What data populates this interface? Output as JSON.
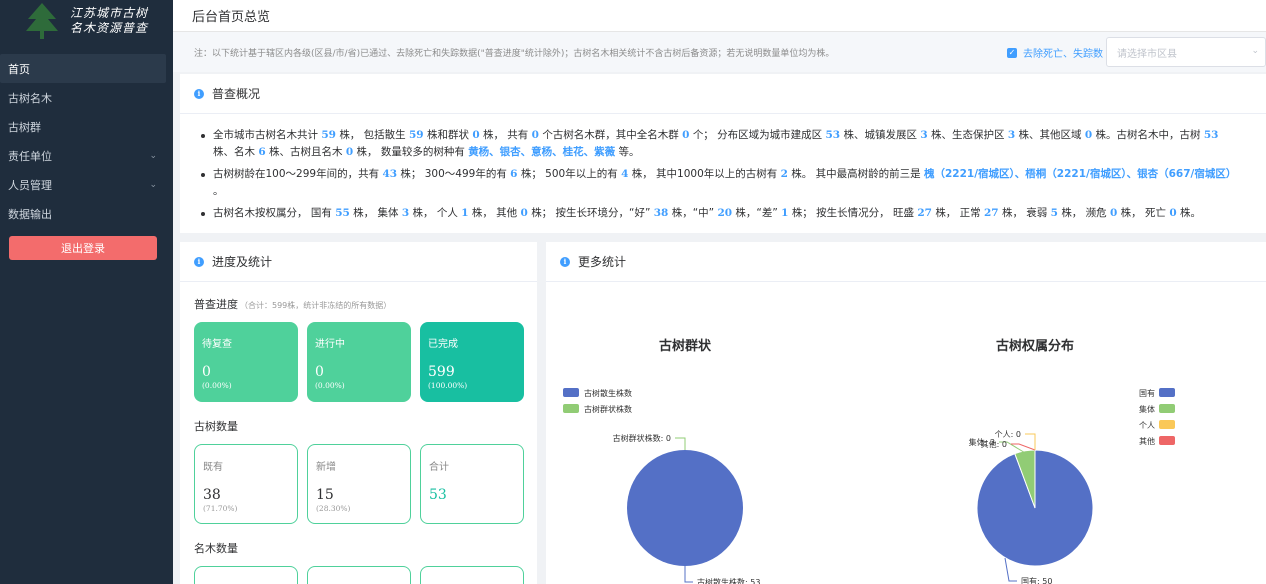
{
  "sidebar": {
    "logo_line1": "江苏城市古树",
    "logo_line2": "名木资源普查",
    "items": [
      {
        "label": "首页"
      },
      {
        "label": "古树名木"
      },
      {
        "label": "古树群"
      },
      {
        "label": "责任单位"
      },
      {
        "label": "人员管理"
      },
      {
        "label": "数据输出"
      }
    ],
    "logout": "退出登录"
  },
  "topbar": {
    "title": "后台首页总览"
  },
  "note": {
    "text": "注：以下统计基于辖区内各级(区县/市/省)已通过、去除死亡和失踪数据(\"普查进度\"统计除外)；古树名木相关统计不含古树后备资源；若无说明数量单位均为株。",
    "checkbox_label": "去除死亡、失踪数",
    "select_placeholder": "请选择市区县"
  },
  "survey": {
    "title": "普查概况",
    "l1": {
      "a": "全市城市古树名木共计",
      "total": "59",
      "b": "株， 包括散生",
      "scattered": "59",
      "c": "株和群状",
      "group": "0",
      "d": "株， 共有",
      "groups": "0",
      "e": "个古树名木群，其中全名木群",
      "fullgroups": "0",
      "f": "个； 分布区域为城市建成区",
      "urban": "53",
      "g": "株、城镇发展区",
      "town": "3",
      "h": "株、生态保护区",
      "eco": "3",
      "i": "株、其他区域",
      "other": "0",
      "j": "株。古树名木中，古树",
      "ancient": "53",
      "k": "株、名木",
      "famous": "6",
      "l": "株、古树且名木",
      "both": "0",
      "m": "株， 数量较多的树种有",
      "species": "黄杨、银杏、意杨、桂花、紫薇",
      "n": "等。"
    },
    "l2": {
      "a": "古树树龄在100～299年间的，共有",
      "c1": "43",
      "b": "株；  300～499年的有",
      "c2": "6",
      "c": "株；  500年以上的有",
      "c3": "4",
      "d": "株， 其中1000年以上的古树有",
      "c4": "2",
      "e": "株。 其中最高树龄的前三是",
      "top3": "槐（2221/宿城区）、梧桐（2221/宿城区）、银杏（667/宿城区）",
      "f": "。"
    },
    "l3": {
      "a": "古树名木按权属分， 国有",
      "gov": "55",
      "b": "株， 集体",
      "coll": "3",
      "c": "株， 个人",
      "ind": "1",
      "d": "株， 其他",
      "oth": "0",
      "e": "株； 按生长环境分，“好”",
      "good": "38",
      "f": "株，“中”",
      "mid": "20",
      "g": "株，“差”",
      "bad": "1",
      "h": "株； 按生长情况分， 旺盛",
      "vig": "27",
      "i": "株， 正常",
      "norm": "27",
      "j": "株， 衰弱",
      "weak": "5",
      "k": "株， 濒危",
      "endg": "0",
      "l": "株， 死亡",
      "dead": "0",
      "m": "株。"
    }
  },
  "progress": {
    "title": "进度及统计",
    "survey_label": "普查进度",
    "survey_note": "（合计：599株，统计非冻结的所有数据）",
    "cards": [
      {
        "title": "待复查",
        "value": "0",
        "pct": "(0.00%)"
      },
      {
        "title": "进行中",
        "value": "0",
        "pct": "(0.00%)"
      },
      {
        "title": "已完成",
        "value": "599",
        "pct": "(100.00%)"
      }
    ],
    "count_label": "古树数量",
    "count_cards": [
      {
        "title": "既有",
        "value": "38",
        "pct": "(71.70%)"
      },
      {
        "title": "新增",
        "value": "15",
        "pct": "(28.30%)"
      },
      {
        "title": "合计",
        "value": "53",
        "pct": ""
      }
    ],
    "famous_label": "名木数量"
  },
  "more": {
    "title": "更多统计",
    "colors": {
      "blue": "#5470c6",
      "green": "#91cc75",
      "yellow": "#fac858",
      "red": "#ee6666"
    },
    "chart_data": [
      {
        "type": "pie",
        "title": "古树群状",
        "categories": [
          "古树散生株数",
          "古树群状株数"
        ],
        "values": [
          53,
          0
        ],
        "labels": [
          "古树散生株数: 53",
          "古树群状株数: 0"
        ],
        "legend": "top-left"
      },
      {
        "type": "pie",
        "title": "古树权属分布",
        "categories": [
          "国有",
          "集体",
          "个人",
          "其他"
        ],
        "values": [
          50,
          3,
          0,
          0
        ],
        "labels": [
          "国有: 50",
          "集体: 3",
          "个人: 0",
          "其他: 0"
        ],
        "legend": "top-right"
      }
    ]
  }
}
